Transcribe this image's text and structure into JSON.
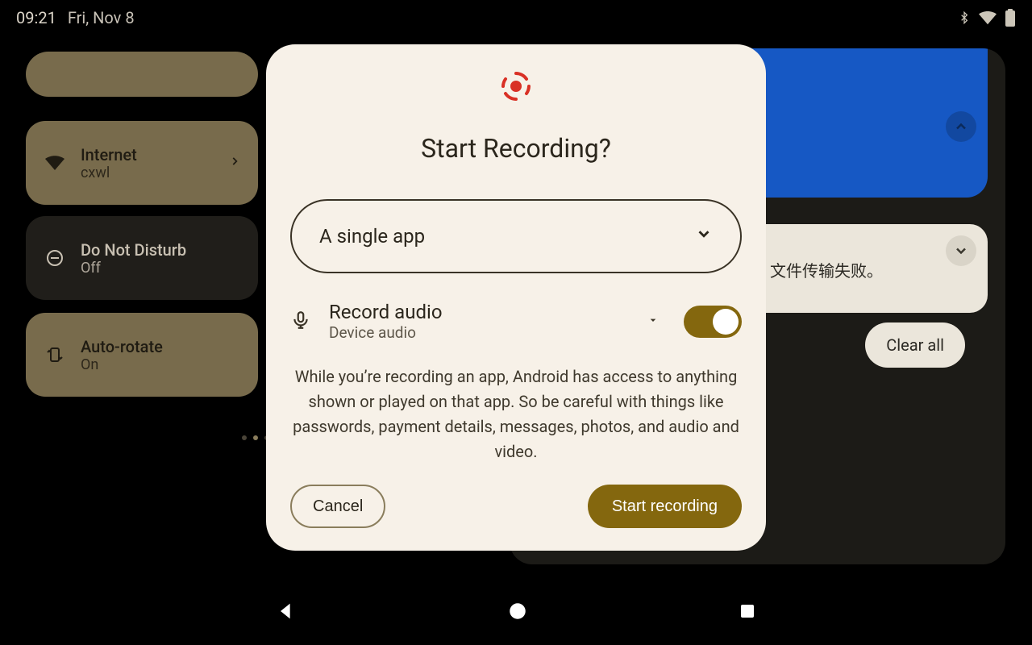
{
  "statusbar": {
    "time": "09:21",
    "date": "Fri, Nov 8"
  },
  "qs": {
    "internet": {
      "title": "Internet",
      "subtitle": "cxwl"
    },
    "dnd": {
      "title": "Do Not Disturb",
      "subtitle": "Off"
    },
    "rotate": {
      "title": "Auto-rotate",
      "subtitle": "On"
    }
  },
  "notif": {
    "sub_text": "文件传输失败。",
    "clear_all": "Clear all"
  },
  "dialog": {
    "title": "Start Recording?",
    "dropdown_value": "A single app",
    "audio_title": "Record audio",
    "audio_subtitle": "Device audio",
    "disclosure": "While you’re recording an app, Android has access to anything shown or played on that app. So be careful with things like passwords, payment details, messages, photos, and audio and video.",
    "cancel": "Cancel",
    "start": "Start recording"
  }
}
